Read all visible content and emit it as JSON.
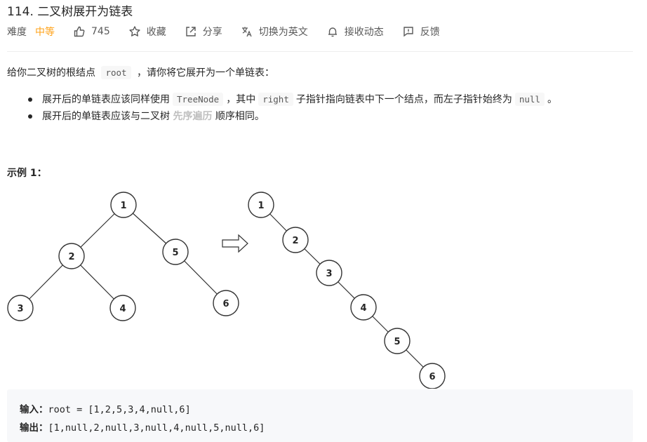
{
  "problem": {
    "title": "114. 二叉树展开为链表"
  },
  "meta": {
    "difficulty_label": "难度",
    "difficulty_value": "中等",
    "difficulty_color": "#ffa116",
    "likes": "745",
    "favorite_label": "收藏",
    "share_label": "分享",
    "translate_label": "切换为英文",
    "notify_label": "接收动态",
    "feedback_label": "反馈",
    "icons": [
      "thumbs-up-icon",
      "star-icon",
      "share-icon",
      "translate-icon",
      "bell-icon",
      "feedback-icon"
    ]
  },
  "description": {
    "intro_pre": "给你二叉树的根结点",
    "intro_code": "root",
    "intro_post": "，请你将它展开为一个单链表：",
    "bullet1_pre": "展开后的单链表应该同样使用",
    "bullet1_code1": "TreeNode",
    "bullet1_mid1": "，其中",
    "bullet1_code2": "right",
    "bullet1_mid2": "子指针指向链表中下一个结点，而左子指针始终为",
    "bullet1_code3": "null",
    "bullet1_post": "。",
    "bullet2_pre": "展开后的单链表应该与二叉树",
    "bullet2_strong": "先序遍历",
    "bullet2_post": "顺序相同。"
  },
  "example": {
    "title": "示例 1：",
    "input_label": "输入：",
    "input_value": "root = [1,2,5,3,4,null,6]",
    "output_label": "输出：",
    "output_value": "[1,null,2,null,3,null,4,null,5,null,6]"
  },
  "diagram": {
    "tree_nodes": [
      "1",
      "2",
      "5",
      "3",
      "4",
      "6"
    ],
    "list_nodes": [
      "1",
      "2",
      "3",
      "4",
      "5",
      "6"
    ]
  }
}
